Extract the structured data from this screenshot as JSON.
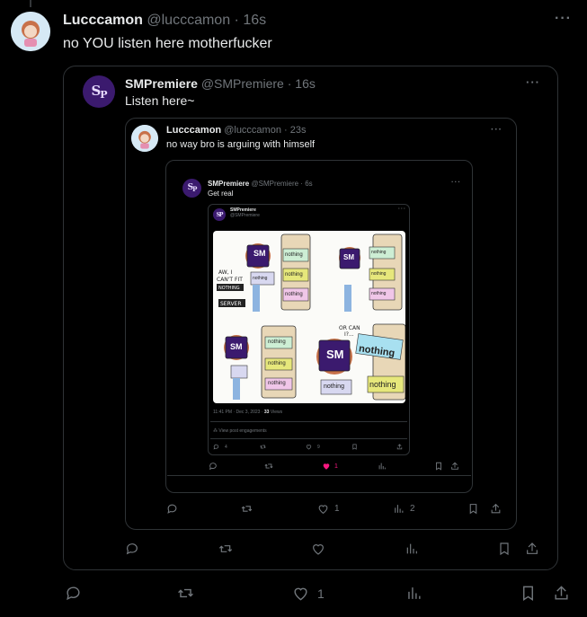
{
  "main_tweet": {
    "name": "Lucccamon",
    "handle": "@lucccamon",
    "time": "16s",
    "text": "no YOU listen here motherfucker",
    "likes": "1"
  },
  "quote1": {
    "name": "SMPremiere",
    "handle": "@SMPremiere",
    "time": "16s",
    "text": "Listen here~"
  },
  "quote2": {
    "name": "Lucccamon",
    "handle": "@lucccamon",
    "time": "23s",
    "text": "no way bro is arguing with himself",
    "likes": "1",
    "views": "2"
  },
  "quote3": {
    "name": "SMPremiere",
    "handle": "@SMPremiere",
    "time": "6s",
    "text": "Get real",
    "likes": "1"
  },
  "quote4": {
    "name": "SMPremiere",
    "handle": "@SMPremiere",
    "meta": "11:41 PM · Dec 3, 2023 · ",
    "views_num": "33",
    "views_word": " Views",
    "engagements": "View post engagements",
    "replies": "4",
    "likes": "9"
  },
  "comic": {
    "speech1": "AW, I CAN'T FIT NOTHING INTO MY SERVER",
    "speech2": "OR CAN I?...",
    "box_word": "nothing",
    "logo": "SM"
  },
  "colors": {
    "like_active": "#f91880",
    "card_border": "#2f3336",
    "muted": "#71767b"
  }
}
